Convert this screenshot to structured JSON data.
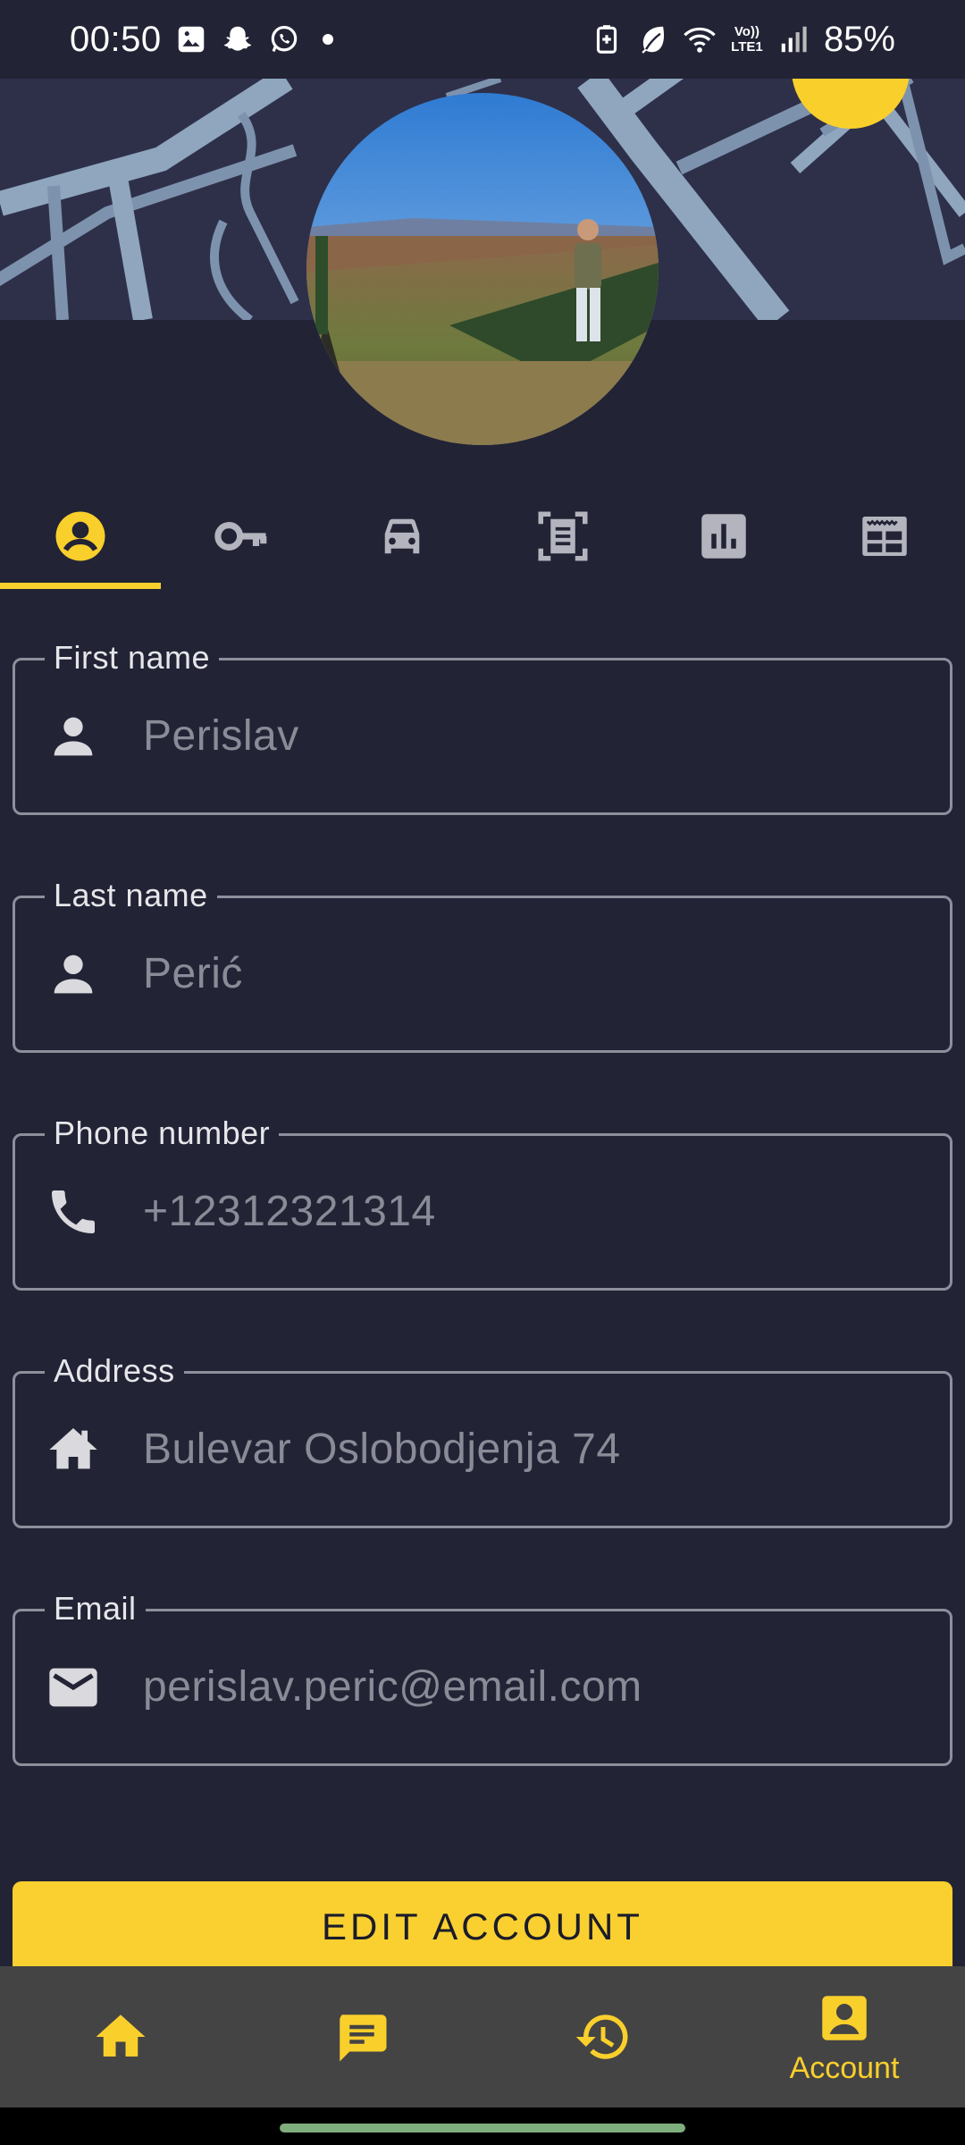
{
  "status_bar": {
    "time": "00:50",
    "battery": "85%",
    "network_label": "Vo)) LTE1",
    "left_icons": [
      "gallery-icon",
      "snapchat-icon",
      "whatsapp-icon",
      "dot-icon"
    ],
    "right_icons": [
      "battery-saver-icon",
      "leaf-icon",
      "wifi-icon",
      "lte-icon",
      "signal-icon"
    ]
  },
  "profile": {
    "avatar_icon": "profile-photo"
  },
  "tabs": [
    {
      "icon": "account-circle-icon",
      "selected": true
    },
    {
      "icon": "key-icon",
      "selected": false
    },
    {
      "icon": "car-icon",
      "selected": false
    },
    {
      "icon": "document-scan-icon",
      "selected": false
    },
    {
      "icon": "bar-chart-icon",
      "selected": false
    },
    {
      "icon": "calendar-table-icon",
      "selected": false
    }
  ],
  "form": {
    "first_name": {
      "label": "First name",
      "value": "Perislav",
      "icon": "person-icon"
    },
    "last_name": {
      "label": "Last name",
      "value": "Perić",
      "icon": "person-icon"
    },
    "phone": {
      "label": "Phone number",
      "value": "+12312321314",
      "icon": "phone-icon"
    },
    "address": {
      "label": "Address",
      "value": "Bulevar Oslobodjenja 74",
      "icon": "home-icon"
    },
    "email": {
      "label": "Email",
      "value": "perislav.peric@email.com",
      "icon": "mail-icon"
    }
  },
  "edit_button": {
    "label": "EDIT ACCOUNT"
  },
  "bottom_nav": [
    {
      "icon": "home-icon",
      "label": ""
    },
    {
      "icon": "chat-icon",
      "label": ""
    },
    {
      "icon": "history-icon",
      "label": ""
    },
    {
      "icon": "account-box-icon",
      "label": "Account",
      "selected": true
    }
  ],
  "colors": {
    "background": "#222335",
    "accent": "#f9cf2c",
    "field_border": "#8e8f9c",
    "field_value": "#8a8b97",
    "nav_background": "#444444",
    "map_background": "#2e3049",
    "map_roads": "#8fa6be"
  }
}
